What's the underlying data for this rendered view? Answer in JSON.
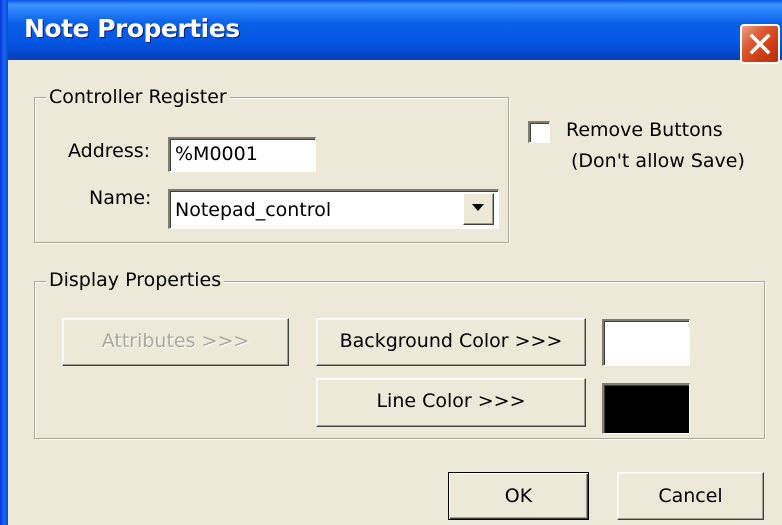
{
  "window": {
    "title": "Note Properties"
  },
  "controller_register": {
    "legend": "Controller Register",
    "address_label": "Address:",
    "address_value": "%M0001",
    "name_label": "Name:",
    "name_value": "Notepad_control"
  },
  "remove_buttons": {
    "label": "Remove Buttons",
    "sublabel": "(Don't allow Save)",
    "checked": false
  },
  "display_properties": {
    "legend": "Display Properties",
    "attributes_label": "Attributes >>>",
    "background_color_label": "Background Color >>>",
    "line_color_label": "Line Color >>>",
    "background_color": "#ffffff",
    "line_color": "#000000"
  },
  "footer": {
    "ok_label": "OK",
    "cancel_label": "Cancel"
  },
  "icons": {
    "close": "close-icon",
    "dropdown": "chevron-down-icon"
  }
}
